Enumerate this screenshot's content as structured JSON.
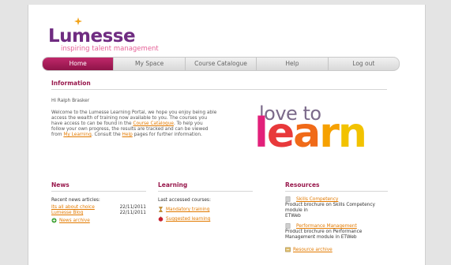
{
  "logo": {
    "name": "Lumesse",
    "tagline": "inspiring talent management"
  },
  "nav": {
    "home": "Home",
    "my_space": "My Space",
    "course_catalogue": "Course Catalogue",
    "help": "Help",
    "log_out": "Log out"
  },
  "info": {
    "title": "Information",
    "greeting": "Hi Ralph Brasker",
    "welcome_p1": "Welcome to the Lumesse Learning Portal, we hope you enjoy being able",
    "welcome_p2": "access the wealth of training now available to you. The courses you",
    "welcome_p3a": "have access to can be found in the ",
    "welcome_link1": "Course Catalogue",
    "welcome_p3b": ". To help you",
    "welcome_p4": "follow your own progress, the results are tracked and can be viewed",
    "welcome_p5a": "from ",
    "welcome_link2": "My Learning",
    "welcome_p5b": ". Consult the ",
    "welcome_link3": "Help",
    "welcome_p5c": " pages for further information."
  },
  "banner": {
    "line1": "love to",
    "line2_letters": [
      "l",
      "e",
      "a",
      "r",
      "n"
    ],
    "colors": [
      "#e2207a",
      "#e8393b",
      "#f06a18",
      "#f6a100",
      "#f2c200"
    ]
  },
  "news": {
    "title": "News",
    "subtitle": "Recent news articles:",
    "items": [
      {
        "label": "Its all about choice",
        "date": "22/11/2011"
      },
      {
        "label": "Lumesse Blog",
        "date": "22/11/2011"
      }
    ],
    "archive": "News archive"
  },
  "learning": {
    "title": "Learning",
    "subtitle": "Last accessed courses:",
    "items": [
      "Mandatory training",
      "Suggested learning"
    ]
  },
  "resources": {
    "title": "Resources",
    "items": [
      {
        "label": "Skills Competency",
        "desc1": "Product brochure on Skills Competency module in",
        "desc2": "ETWeb"
      },
      {
        "label": "Performance Management",
        "desc1": "Product brochure on Performance",
        "desc2": "Management module in ETWeb"
      }
    ],
    "archive": "Resource archive"
  }
}
